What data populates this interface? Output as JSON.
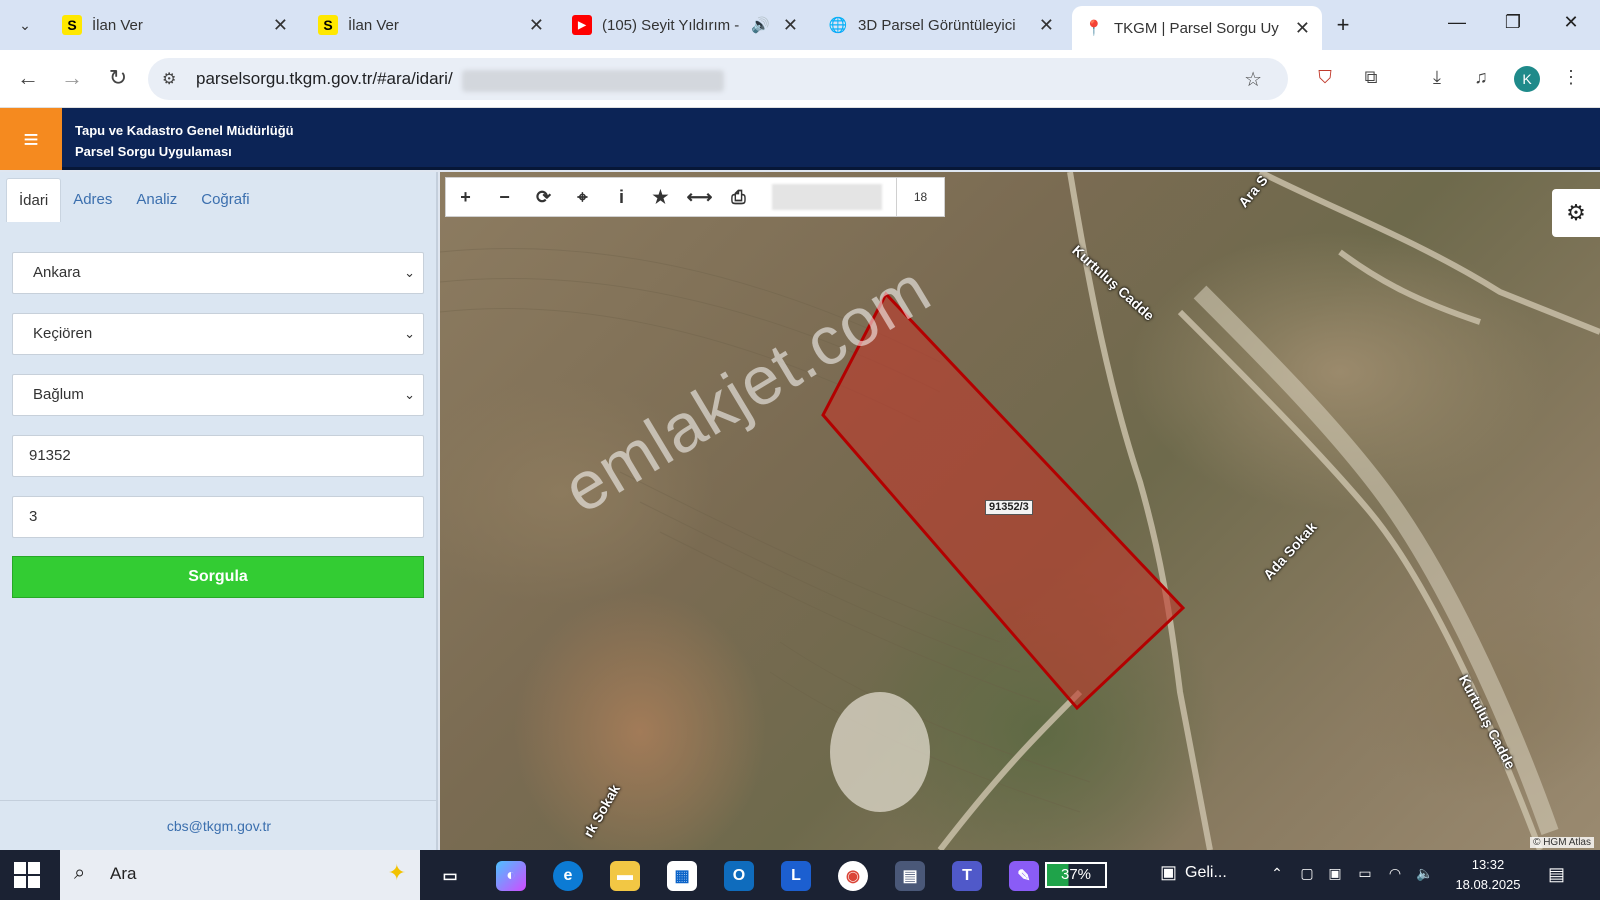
{
  "browser": {
    "tabs": [
      {
        "label": "İlan Ver",
        "icon": "sahibinden-icon",
        "glyph": "S",
        "active": false
      },
      {
        "label": "İlan Ver",
        "icon": "sahibinden-icon",
        "glyph": "S",
        "active": false
      },
      {
        "label": "(105) Seyit Yıldırım -",
        "icon": "youtube-icon",
        "glyph": "▶",
        "active": false
      },
      {
        "label": "3D Parsel Görüntüleyici",
        "icon": "globe-icon",
        "glyph": "🌐",
        "active": false
      },
      {
        "label": "TKGM | Parsel Sorgu Uyg",
        "icon": "map-pin-icon",
        "glyph": "📍",
        "active": true
      }
    ],
    "new_tab": "+",
    "url": "parselsorgu.tkgm.gov.tr/#ara/idari/"
  },
  "app": {
    "org_name": "Tapu ve Kadastro Genel Müdürlüğü",
    "app_name": "Parsel Sorgu Uygulaması"
  },
  "sidebar": {
    "tabs": [
      "İdari",
      "Adres",
      "Analiz",
      "Coğrafi"
    ],
    "province": "Ankara",
    "district": "Keçiören",
    "neighborhood": "Bağlum",
    "block": "91352",
    "parcel": "3",
    "submit_label": "Sorgula",
    "footer_email": "cbs@tkgm.gov.tr"
  },
  "map": {
    "zoom": "18",
    "parcel_label": "91352/3",
    "watermark": "emlakjet.com",
    "attribution": "© HGM Atlas",
    "roads": [
      "Kurtuluş Cadde",
      "Ada Sokak",
      "Kurtuluş Cadde",
      "Ara S",
      "rk Sokak"
    ],
    "parcel_fill": "#c0392b",
    "parcel_stroke": "#b30000"
  },
  "taskbar": {
    "search_label": "Ara",
    "battery": "37%",
    "news_label": "Geli...",
    "time": "13:32",
    "date": "18.08.2025"
  },
  "colors": {
    "header_bg": "#0c2456",
    "hamburger_bg": "#f58a1f",
    "submit_bg": "#33cc33"
  }
}
